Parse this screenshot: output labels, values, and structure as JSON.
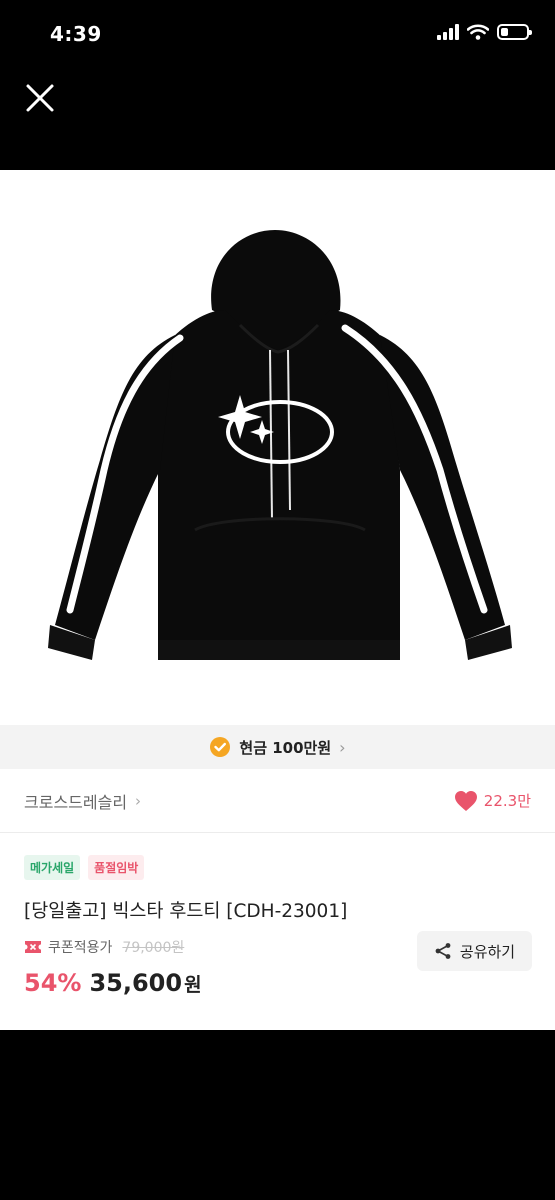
{
  "status_bar": {
    "time": "4:39",
    "battery_level": 0.3
  },
  "close_icon": "close-icon",
  "product_image": {
    "icon": "hoodie-image"
  },
  "cash_banner": {
    "icon": "check-badge-icon",
    "text": "현금 100만원"
  },
  "shop": {
    "name": "크로스드레슬리",
    "likes": "22.3만"
  },
  "badges": {
    "mega": "메가세일",
    "soldout": "품절임박"
  },
  "title": "[당일출고] 빅스타 후드티 [CDH-23001]",
  "coupon": {
    "label": "쿠폰적용가",
    "original_price": "79,000원"
  },
  "price": {
    "discount": "54%",
    "amount": "35,600",
    "unit": "원"
  },
  "share": {
    "label": "공유하기"
  },
  "colors": {
    "accent": "#e9546b",
    "orange": "#f5a623",
    "green": "#2aa66a"
  }
}
